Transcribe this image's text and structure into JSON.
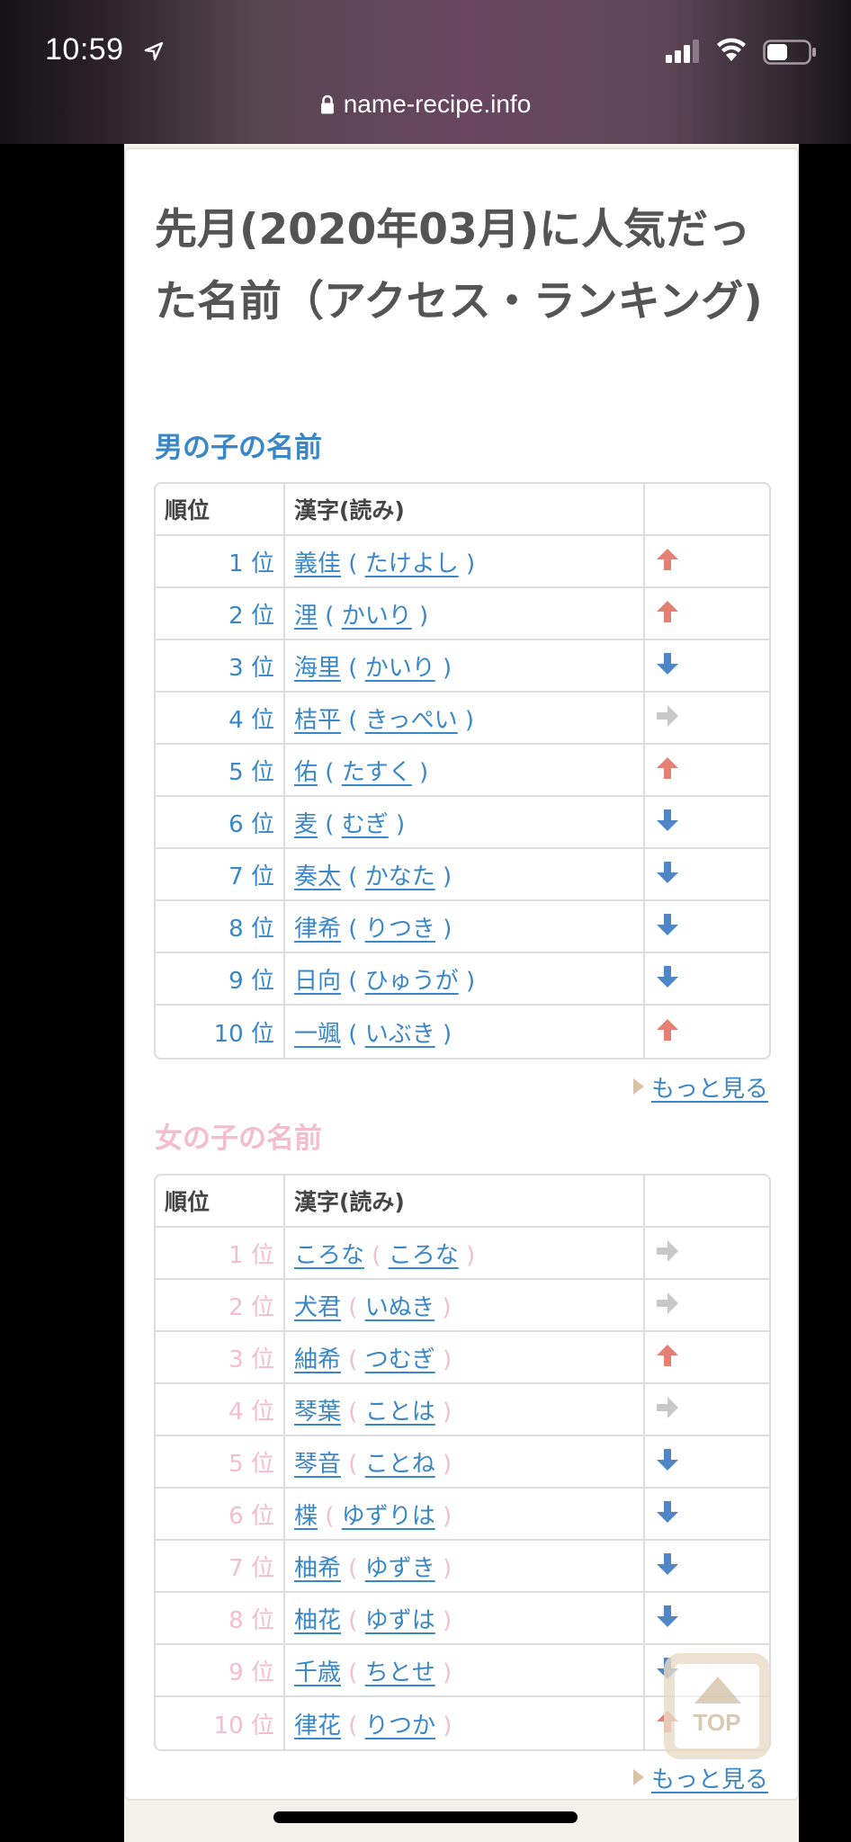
{
  "status_bar": {
    "time": "10:59",
    "icons": [
      "location-arrow-icon",
      "signal-icon",
      "wifi-icon",
      "battery-icon"
    ]
  },
  "browser": {
    "url": "name-recipe.info",
    "lock_icon": "lock-icon"
  },
  "page": {
    "title": "先月(2020年03月)に人気だった名前（アクセス・ランキング)",
    "columns": {
      "rank": "順位",
      "name": "漢字(読み)",
      "trend": ""
    },
    "rank_suffix": "位",
    "more_label": "もっと見る",
    "top_button_label": "TOP"
  },
  "colors": {
    "boys_accent": "#3a87c8",
    "girls_accent": "#f4bdcb",
    "up": "#e57f74",
    "down": "#4f86c6",
    "same": "#c8c8c8"
  },
  "boys": {
    "heading": "男の子の名前",
    "rows": [
      {
        "rank": "1",
        "kanji": "義佳",
        "reading": "たけよし",
        "trend": "up"
      },
      {
        "rank": "2",
        "kanji": "浬",
        "reading": "かいり",
        "trend": "up"
      },
      {
        "rank": "3",
        "kanji": "海里",
        "reading": "かいり",
        "trend": "down"
      },
      {
        "rank": "4",
        "kanji": "桔平",
        "reading": "きっぺい",
        "trend": "same"
      },
      {
        "rank": "5",
        "kanji": "佑",
        "reading": "たすく",
        "trend": "up"
      },
      {
        "rank": "6",
        "kanji": "麦",
        "reading": "むぎ",
        "trend": "down"
      },
      {
        "rank": "7",
        "kanji": "奏太",
        "reading": "かなた",
        "trend": "down"
      },
      {
        "rank": "8",
        "kanji": "律希",
        "reading": "りつき",
        "trend": "down"
      },
      {
        "rank": "9",
        "kanji": "日向",
        "reading": "ひゅうが",
        "trend": "down"
      },
      {
        "rank": "10",
        "kanji": "一颯",
        "reading": "いぶき",
        "trend": "up"
      }
    ]
  },
  "girls": {
    "heading": "女の子の名前",
    "rows": [
      {
        "rank": "1",
        "kanji": "ころな",
        "reading": "ころな",
        "trend": "same"
      },
      {
        "rank": "2",
        "kanji": "犬君",
        "reading": "いぬき",
        "trend": "same"
      },
      {
        "rank": "3",
        "kanji": "紬希",
        "reading": "つむぎ",
        "trend": "up"
      },
      {
        "rank": "4",
        "kanji": "琴葉",
        "reading": "ことは",
        "trend": "same"
      },
      {
        "rank": "5",
        "kanji": "琴音",
        "reading": "ことね",
        "trend": "down"
      },
      {
        "rank": "6",
        "kanji": "楪",
        "reading": "ゆずりは",
        "trend": "down"
      },
      {
        "rank": "7",
        "kanji": "柚希",
        "reading": "ゆずき",
        "trend": "down"
      },
      {
        "rank": "8",
        "kanji": "柚花",
        "reading": "ゆずは",
        "trend": "down"
      },
      {
        "rank": "9",
        "kanji": "千歳",
        "reading": "ちとせ",
        "trend": "down"
      },
      {
        "rank": "10",
        "kanji": "律花",
        "reading": "りつか",
        "trend": "up"
      }
    ]
  }
}
